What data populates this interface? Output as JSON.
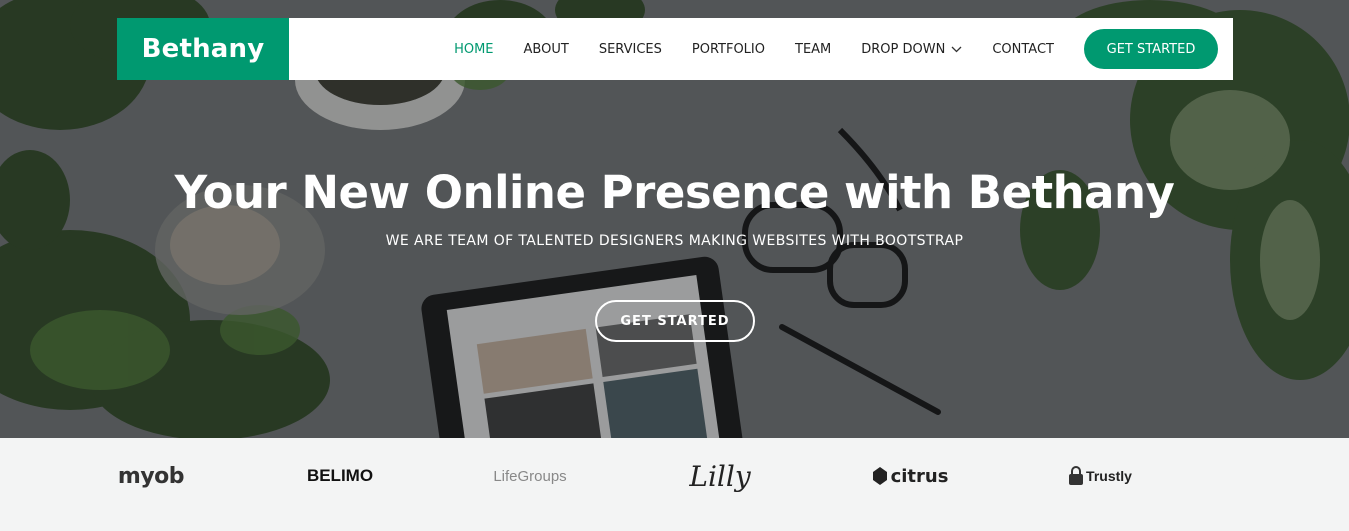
{
  "brand": {
    "name": "Bethany",
    "accent": "#009970"
  },
  "nav": {
    "items": [
      {
        "label": "HOME",
        "active": true
      },
      {
        "label": "ABOUT"
      },
      {
        "label": "SERVICES"
      },
      {
        "label": "PORTFOLIO"
      },
      {
        "label": "TEAM"
      },
      {
        "label": "DROP DOWN",
        "icon": "chevron-down-icon"
      },
      {
        "label": "CONTACT"
      }
    ],
    "cta": "GET STARTED"
  },
  "hero": {
    "title": "Your New Online Presence with Bethany",
    "subtitle": "WE ARE TEAM OF TALENTED DESIGNERS MAKING WEBSITES WITH BOOTSTRAP",
    "button": "GET STARTED"
  },
  "clients": [
    {
      "name": "myob"
    },
    {
      "name": "BELIMO"
    },
    {
      "name": "LifeGroups"
    },
    {
      "name": "Lilly"
    },
    {
      "name": "citrus"
    },
    {
      "name": "Trustly"
    }
  ]
}
